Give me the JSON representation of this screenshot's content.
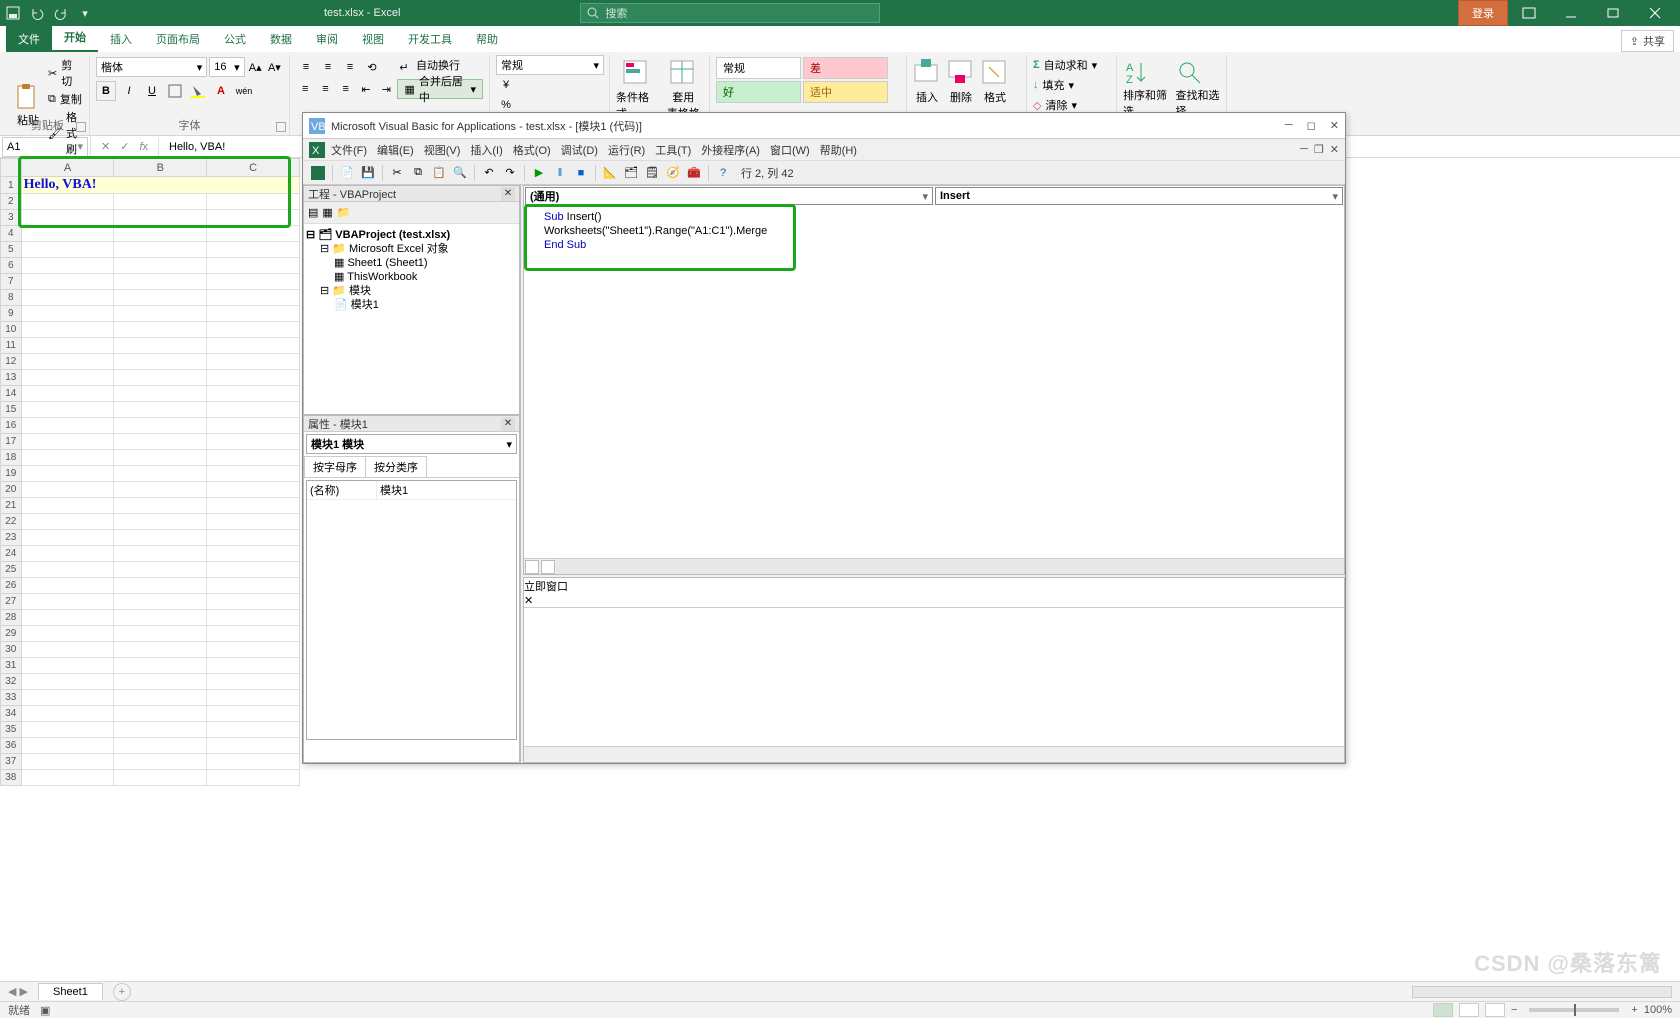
{
  "titlebar": {
    "doc": "test.xlsx - Excel",
    "search_placeholder": "搜索",
    "login": "登录"
  },
  "tabs": {
    "file": "文件",
    "home": "开始",
    "insert": "插入",
    "layout": "页面布局",
    "formulas": "公式",
    "data": "数据",
    "review": "审阅",
    "view": "视图",
    "dev": "开发工具",
    "help": "帮助",
    "share": "共享"
  },
  "ribbon": {
    "clipboard": {
      "paste": "粘贴",
      "cut": "剪切",
      "copy": "复制",
      "painter": "格式刷",
      "label": "剪贴板"
    },
    "font": {
      "name": "楷体",
      "size": "16",
      "label": "字体",
      "pinyin": "wén"
    },
    "align": {
      "wrap": "自动换行",
      "merge": "合并后居中"
    },
    "number": {
      "format": "常规"
    },
    "cfmt": {
      "cond": "条件格式",
      "table": "套用\n表格格式"
    },
    "gallery": {
      "normal": "常规",
      "bad": "差",
      "good": "好",
      "neutral": "适中"
    },
    "cells": {
      "insert": "插入",
      "delete": "删除",
      "format": "格式"
    },
    "edit": {
      "sum": "自动求和",
      "fill": "填充",
      "clear": "清除"
    },
    "sort": {
      "sort": "排序和筛选",
      "find": "查找和选择"
    }
  },
  "formula_bar": {
    "cell": "A1",
    "value": "Hello, VBA!"
  },
  "sheet": {
    "cols": [
      "A",
      "B",
      "C"
    ],
    "rows": 38,
    "merged_value": "Hello, VBA!"
  },
  "sheettabs": {
    "tab": "Sheet1"
  },
  "status": {
    "ready": "就绪",
    "zoom": "100%"
  },
  "vba": {
    "title": "Microsoft Visual Basic for Applications - test.xlsx - [模块1 (代码)]",
    "menus": [
      "文件(F)",
      "编辑(E)",
      "视图(V)",
      "插入(I)",
      "格式(O)",
      "调试(D)",
      "运行(R)",
      "工具(T)",
      "外接程序(A)",
      "窗口(W)",
      "帮助(H)"
    ],
    "cursor": "行 2, 列 42",
    "project": {
      "title": "工程 - VBAProject",
      "root": "VBAProject (test.xlsx)",
      "objects": "Microsoft Excel 对象",
      "sheet": "Sheet1 (Sheet1)",
      "wb": "ThisWorkbook",
      "modules": "模块",
      "mod1": "模块1"
    },
    "props": {
      "title": "属性 - 模块1",
      "obj": "模块1 模块",
      "tab1": "按字母序",
      "tab2": "按分类序",
      "name_k": "(名称)",
      "name_v": "模块1"
    },
    "code": {
      "left": "(通用)",
      "right": "Insert",
      "l1a": "Sub ",
      "l1b": "Insert()",
      "l2": "Worksheets(\"Sheet1\").Range(\"A1:C1\").Merge",
      "l3": "End Sub"
    },
    "immediate": "立即窗口"
  },
  "watermark": "CSDN @桑落东篱"
}
